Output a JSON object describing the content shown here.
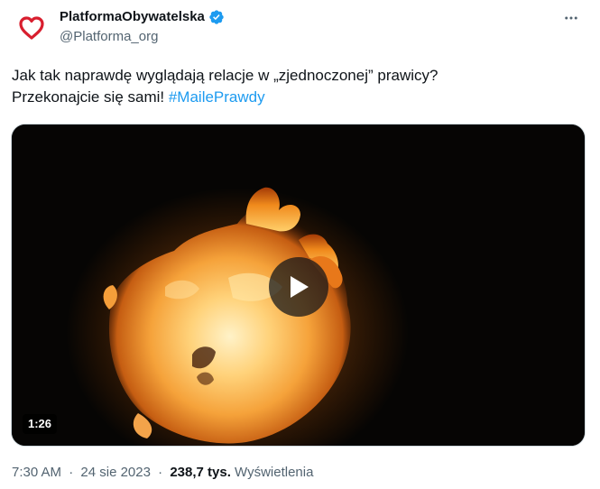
{
  "author": {
    "display_name": "PlatformaObywatelska",
    "handle": "@Platforma_org",
    "verified": true,
    "avatar_icon": "heart-logo-icon",
    "brand_color": "#d81e2e",
    "verified_color": "#1d9bf0"
  },
  "tweet": {
    "text_line1": "Jak tak naprawdę wyglądają relacje w „zjednoczonej” prawicy?",
    "text_line2": "Przekonajcie się sami! ",
    "hashtag": "#MailePrawdy"
  },
  "media": {
    "type": "video",
    "duration": "1:26",
    "play_icon": "play-icon"
  },
  "meta": {
    "time": "7:30 AM",
    "separator": "·",
    "date": "24 sie 2023",
    "views_count": "238,7 tys.",
    "views_label": "Wyświetlenia"
  },
  "menu": {
    "icon": "more-options-icon"
  }
}
